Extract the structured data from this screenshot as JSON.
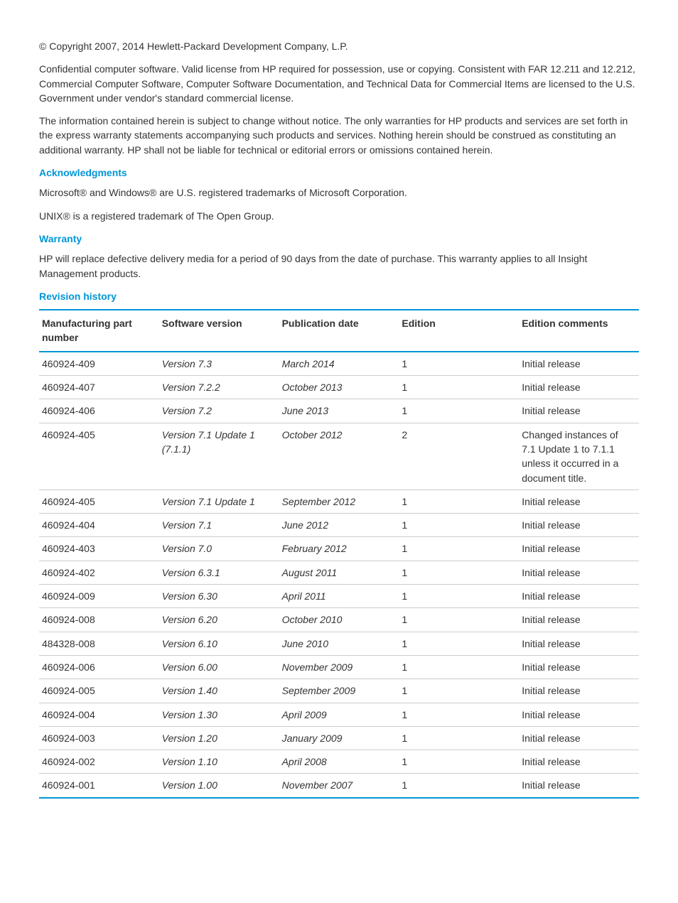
{
  "copyright": "© Copyright 2007, 2014 Hewlett-Packard Development Company, L.P.",
  "para1": "Confidential computer software. Valid license from HP required for possession, use or copying. Consistent with FAR 12.211 and 12.212, Commercial Computer Software, Computer Software Documentation, and Technical Data for Commercial Items are licensed to the U.S. Government under vendor's standard commercial license.",
  "para2": "The information contained herein is subject to change without notice. The only warranties for HP products and services are set forth in the express warranty statements accompanying such products and services. Nothing herein should be construed as constituting an additional warranty. HP shall not be liable for technical or editorial errors or omissions contained herein.",
  "ack_heading": "Acknowledgments",
  "ack_para1": "Microsoft® and Windows® are U.S. registered trademarks of Microsoft Corporation.",
  "ack_para2": "UNIX® is a registered trademark of The Open Group.",
  "warranty_heading": "Warranty",
  "warranty_para": "HP will replace defective delivery media for a period of 90 days from the date of purchase. This warranty applies to all Insight Management products.",
  "revision_heading": "Revision history",
  "table_headers": {
    "part": "Manufacturing part number",
    "version": "Software version",
    "date": "Publication date",
    "edition": "Edition",
    "comments": "Edition comments"
  },
  "rows": [
    {
      "part": "460924-409",
      "version": "Version 7.3",
      "date": "March 2014",
      "edition": "1",
      "comments": "Initial release"
    },
    {
      "part": "460924-407",
      "version": "Version 7.2.2",
      "date": "October 2013",
      "edition": "1",
      "comments": "Initial release"
    },
    {
      "part": "460924-406",
      "version": "Version 7.2",
      "date": "June 2013",
      "edition": "1",
      "comments": "Initial release"
    },
    {
      "part": "460924-405",
      "version": "Version 7.1 Update 1 (7.1.1)",
      "date": "October 2012",
      "edition": "2",
      "comments": "Changed instances of 7.1 Update 1 to 7.1.1 unless it occurred in a document title."
    },
    {
      "part": "460924-405",
      "version": "Version 7.1 Update 1",
      "date": "September 2012",
      "edition": "1",
      "comments": "Initial release"
    },
    {
      "part": "460924-404",
      "version": "Version 7.1",
      "date": "June 2012",
      "edition": "1",
      "comments": "Initial release"
    },
    {
      "part": "460924-403",
      "version": "Version 7.0",
      "date": "February 2012",
      "edition": "1",
      "comments": "Initial release"
    },
    {
      "part": "460924-402",
      "version": "Version 6.3.1",
      "date": "August 2011",
      "edition": "1",
      "comments": "Initial release"
    },
    {
      "part": "460924-009",
      "version": "Version 6.30",
      "date": "April 2011",
      "edition": "1",
      "comments": "Initial release"
    },
    {
      "part": "460924-008",
      "version": "Version 6.20",
      "date": "October 2010",
      "edition": "1",
      "comments": "Initial release"
    },
    {
      "part": "484328-008",
      "version": "Version 6.10",
      "date": "June 2010",
      "edition": "1",
      "comments": "Initial release"
    },
    {
      "part": "460924-006",
      "version": "Version 6.00",
      "date": "November 2009",
      "edition": "1",
      "comments": "Initial release"
    },
    {
      "part": "460924-005",
      "version": "Version 1.40",
      "date": "September 2009",
      "edition": "1",
      "comments": "Initial release"
    },
    {
      "part": "460924-004",
      "version": "Version 1.30",
      "date": "April 2009",
      "edition": "1",
      "comments": "Initial release"
    },
    {
      "part": "460924-003",
      "version": "Version 1.20",
      "date": "January 2009",
      "edition": "1",
      "comments": "Initial release"
    },
    {
      "part": "460924-002",
      "version": "Version 1.10",
      "date": "April 2008",
      "edition": "1",
      "comments": "Initial release"
    },
    {
      "part": "460924-001",
      "version": "Version 1.00",
      "date": "November 2007",
      "edition": "1",
      "comments": "Initial release"
    }
  ]
}
